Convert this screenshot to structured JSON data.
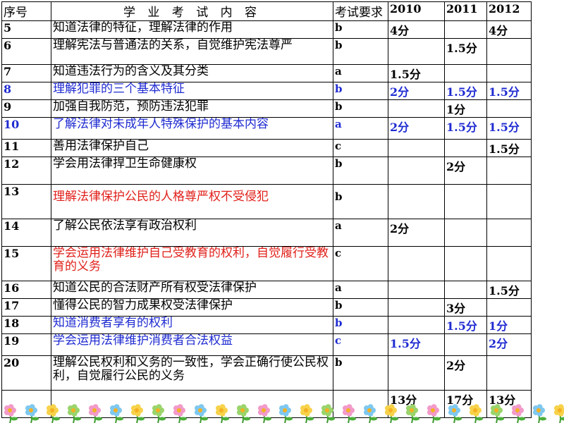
{
  "table": {
    "headers": {
      "num": "序号",
      "content": "学 业 考 试 内 容",
      "req": "考试要求",
      "y2010": "2010",
      "y2011": "2011",
      "y2012": "2012"
    },
    "rows": [
      {
        "num": "5",
        "content": "知道法律的特征，理解法律的作用",
        "req": "b",
        "y2010": "4分",
        "y2011": "",
        "y2012": "4分",
        "color": "black"
      },
      {
        "num": "6",
        "content": "理解宪法与普通法的关系，自觉维护宪法尊严",
        "req": "b",
        "y2010": "",
        "y2011": "1.5分",
        "y2012": "",
        "color": "black"
      },
      {
        "num": "7",
        "content": "知道违法行为的含义及其分类",
        "req": "a",
        "y2010": "1.5分",
        "y2011": "",
        "y2012": "",
        "color": "black"
      },
      {
        "num": "8",
        "content": "理解犯罪的三个基本特征",
        "req": "b",
        "y2010": "2分",
        "y2011": "1.5分",
        "y2012": "1.5分",
        "color": "blue"
      },
      {
        "num": "9",
        "content": "加强自我防范，预防违法犯罪",
        "req": "b",
        "y2010": "",
        "y2011": "1分",
        "y2012": "",
        "color": "black"
      },
      {
        "num": "10",
        "content": "了解法律对未成年人特殊保护的基本内容",
        "req": "a",
        "y2010": "2分",
        "y2011": "1.5分",
        "y2012": "1.5分",
        "color": "blue"
      },
      {
        "num": "11",
        "content": "善用法律保护自己",
        "req": "c",
        "y2010": "",
        "y2011": "",
        "y2012": "1.5分",
        "color": "black"
      },
      {
        "num": "12",
        "content": "学会用法律捍卫生命健康权",
        "req": "b",
        "y2010": "",
        "y2011": "2分",
        "y2012": "",
        "color": "black"
      },
      {
        "num": "13",
        "content": "理解法律保护公民的人格尊严权不受侵犯",
        "req": "b",
        "y2010": "",
        "y2011": "",
        "y2012": "",
        "color": "red"
      },
      {
        "num": "14",
        "content": "了解公民依法享有政治权利",
        "req": "a",
        "y2010": "2分",
        "y2011": "",
        "y2012": "",
        "color": "black"
      },
      {
        "num": "15",
        "content": "学会运用法律维护自己受教育的权利，自觉履行受教育的义务",
        "req": "c",
        "y2010": "",
        "y2011": "",
        "y2012": "",
        "color": "red"
      },
      {
        "num": "16",
        "content": "知道公民的合法财产所有权受法律保护",
        "req": "a",
        "y2010": "",
        "y2011": "",
        "y2012": "1.5分",
        "color": "black"
      },
      {
        "num": "17",
        "content": "懂得公民的智力成果权受法律保护",
        "req": "b",
        "y2010": "",
        "y2011": "3分",
        "y2012": "",
        "color": "black"
      },
      {
        "num": "18",
        "content": "知道消费者享有的权利",
        "req": "b",
        "y2010": "",
        "y2011": "1.5分",
        "y2012": "1分",
        "color": "blue"
      },
      {
        "num": "19",
        "content": "学会运用法律维护消费者合法权益",
        "req": "c",
        "y2010": "1.5分",
        "y2011": "",
        "y2012": "2分",
        "color": "blue"
      },
      {
        "num": "20",
        "content": "理解公民权利和义务的一致性，学会正确行使公民权利，自觉履行公民的义务",
        "req": "b",
        "y2010": "",
        "y2011": "2分",
        "y2012": "",
        "color": "black"
      }
    ],
    "totals": {
      "y2010": "13分",
      "y2011": "17分",
      "y2012": "13分"
    }
  },
  "colors": {
    "blue_text": "#1f2bd1",
    "red_text": "#e0201a"
  }
}
